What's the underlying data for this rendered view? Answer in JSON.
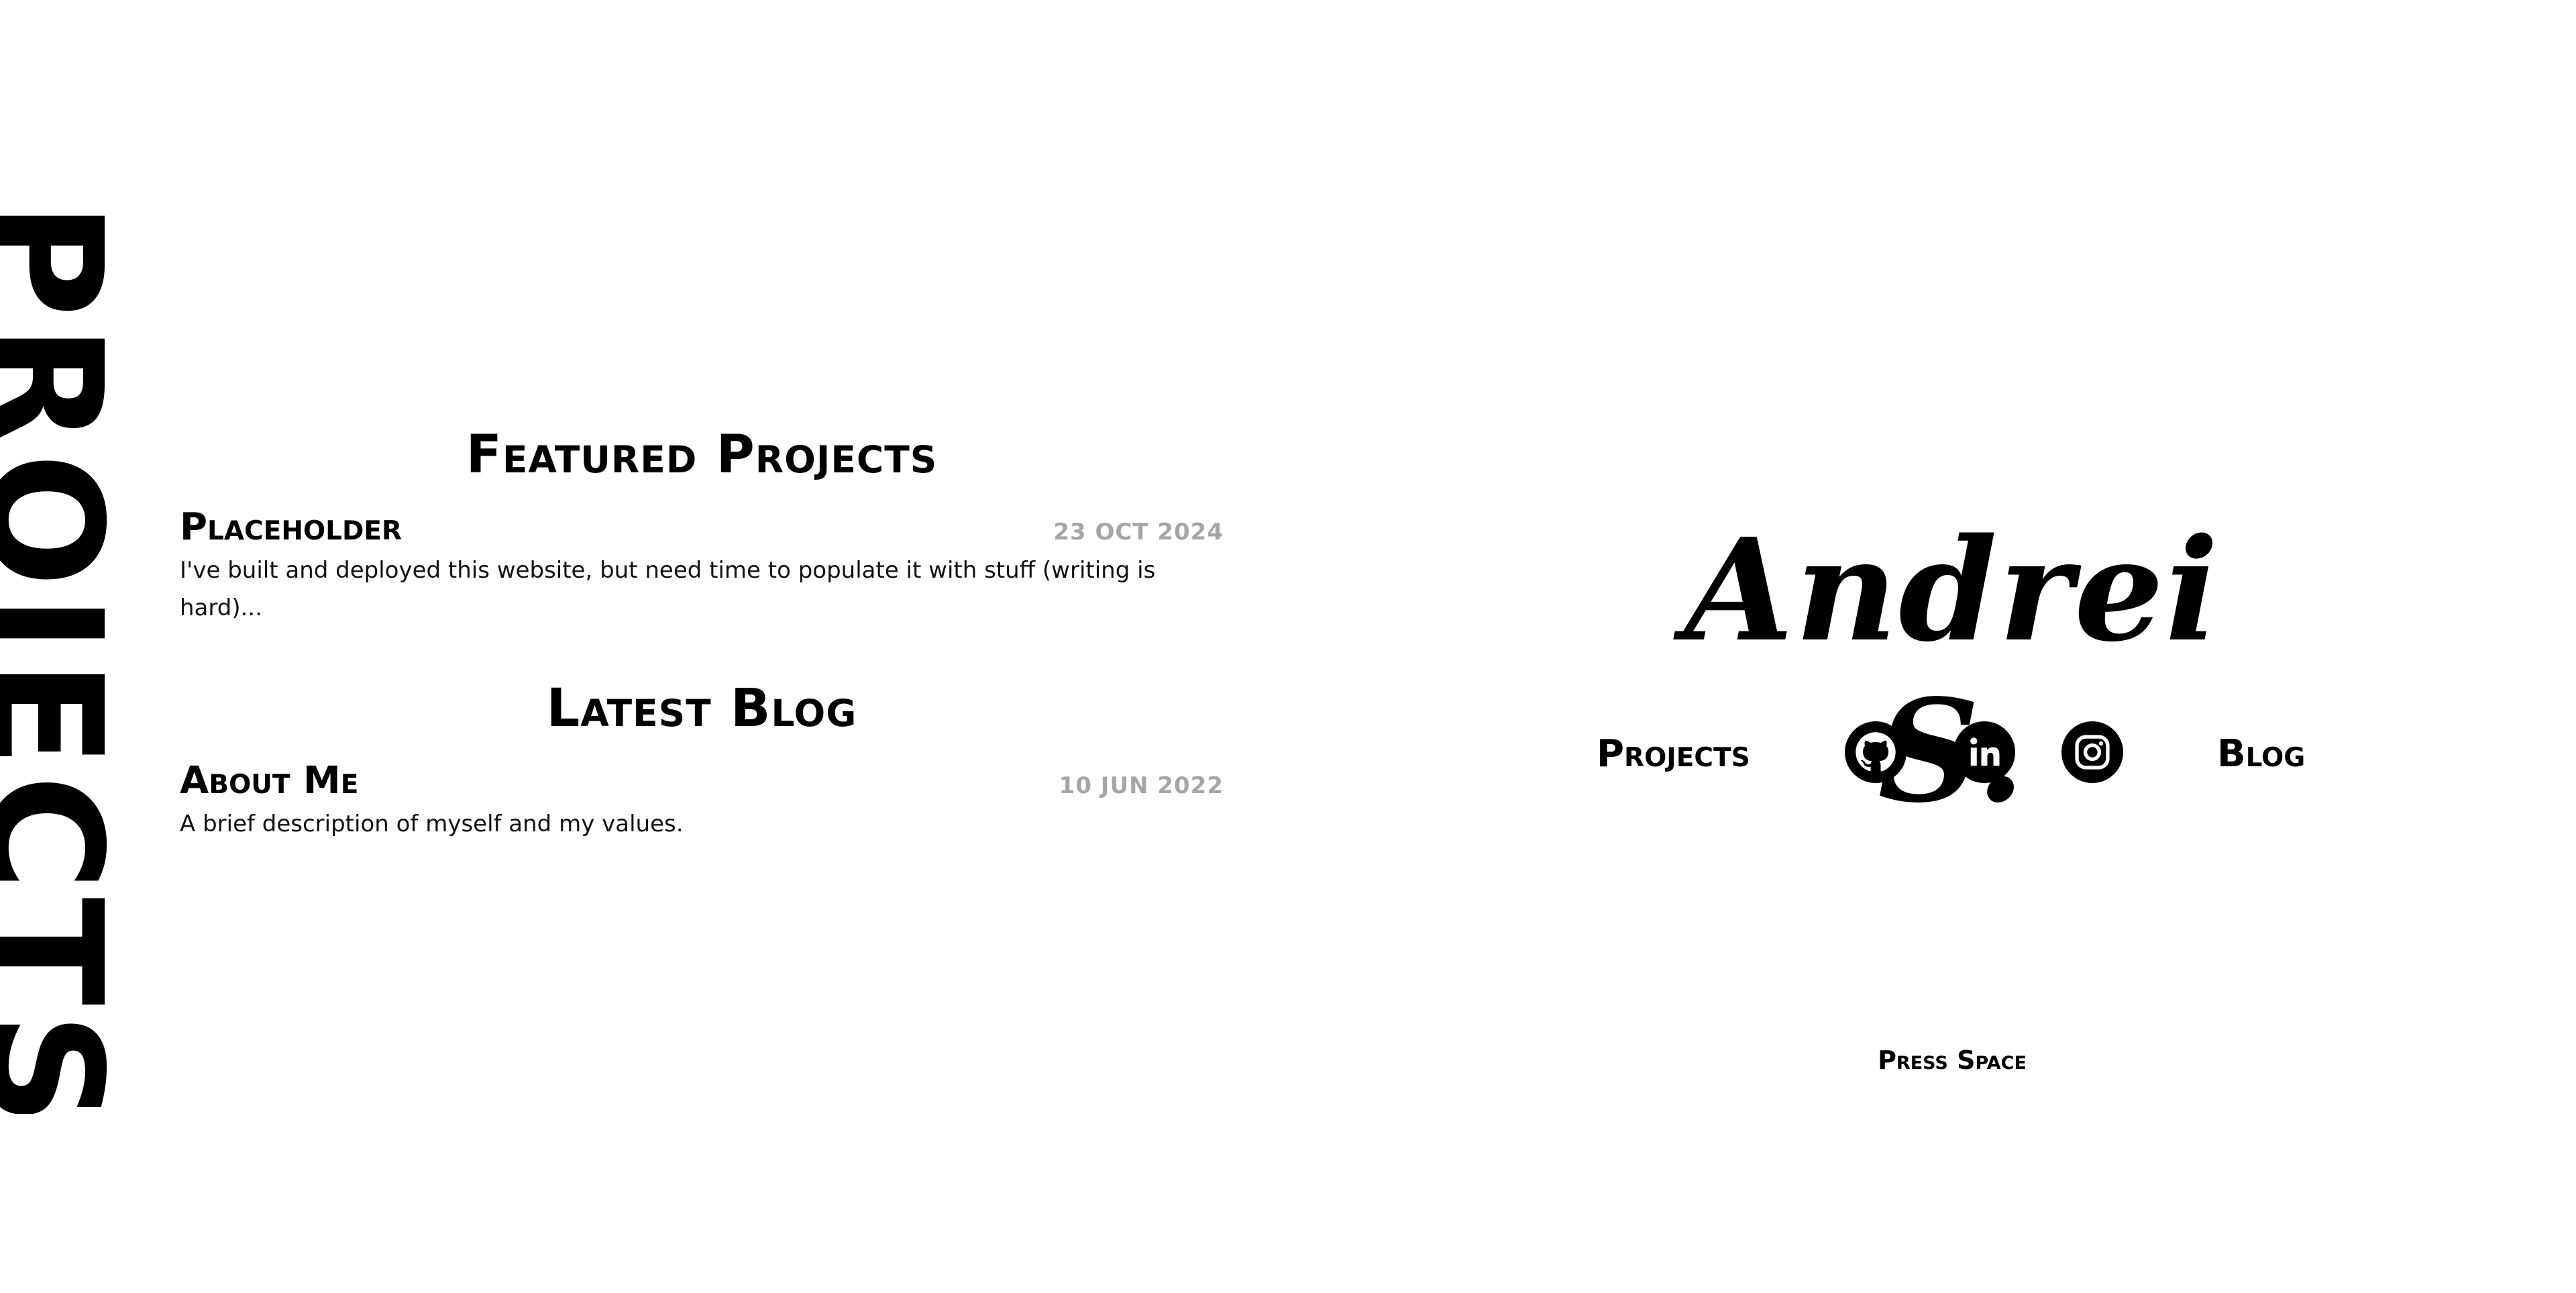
{
  "side": {
    "title": "PROJECTS"
  },
  "featured": {
    "heading": "Featured Projects",
    "items": [
      {
        "title": "Placeholder",
        "date": "23 OCT 2024",
        "description": "I've built and deployed this website, but need time to populate it with stuff (writing is hard)..."
      }
    ]
  },
  "blog": {
    "heading": "Latest Blog",
    "items": [
      {
        "title": "About Me",
        "date": "10 JUN 2022",
        "description": "A brief description of myself and my values."
      }
    ]
  },
  "brand": {
    "name": "Andrei S."
  },
  "nav": {
    "projects_label": "Projects",
    "blog_label": "Blog",
    "social": [
      {
        "icon": "github-icon"
      },
      {
        "icon": "linkedin-icon"
      },
      {
        "icon": "instagram-icon"
      }
    ]
  },
  "hint": {
    "text": "Press Space"
  },
  "colors": {
    "background": "#ffffff",
    "text": "#000000",
    "date": "#a6a6a6"
  }
}
